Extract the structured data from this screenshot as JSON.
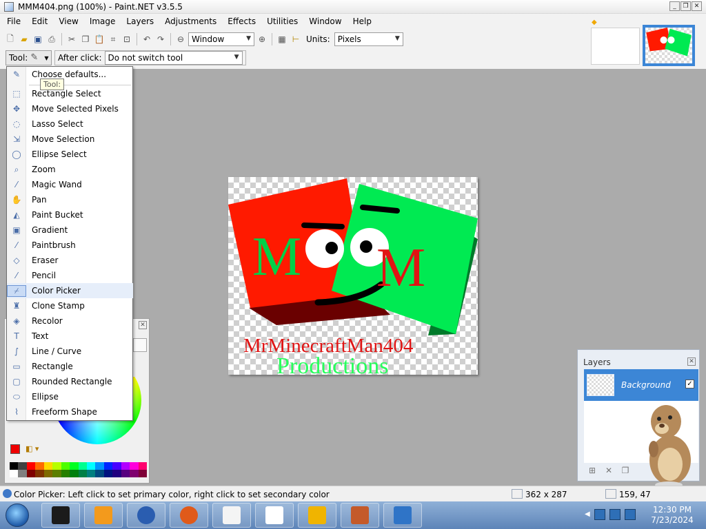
{
  "window": {
    "title": "MMM404.png (100%) - Paint.NET v3.5.5",
    "buttons": {
      "minimize": "_",
      "restore": "❐",
      "close": "✕"
    }
  },
  "menubar": [
    "File",
    "Edit",
    "View",
    "Image",
    "Layers",
    "Adjustments",
    "Effects",
    "Utilities",
    "Window",
    "Help"
  ],
  "toolbar": {
    "zoom_value": "Window",
    "units_label": "Units:",
    "units_value": "Pixels"
  },
  "tool_bar": {
    "tool_label": "Tool:",
    "after_click_label": "After click:",
    "after_click_value": "Do not switch tool",
    "tooltip": "Tool:"
  },
  "tool_menu": {
    "items": [
      {
        "label": "Choose defaults...",
        "icon": "paint-tools-icon"
      },
      {
        "label": "Rectangle Select",
        "icon": "rectangle-select-icon"
      },
      {
        "label": "Move Selected Pixels",
        "icon": "move-pixels-icon"
      },
      {
        "label": "Lasso Select",
        "icon": "lasso-icon"
      },
      {
        "label": "Move Selection",
        "icon": "move-selection-icon"
      },
      {
        "label": "Ellipse Select",
        "icon": "ellipse-select-icon"
      },
      {
        "label": "Zoom",
        "icon": "zoom-icon"
      },
      {
        "label": "Magic Wand",
        "icon": "magic-wand-icon"
      },
      {
        "label": "Pan",
        "icon": "hand-icon"
      },
      {
        "label": "Paint Bucket",
        "icon": "paint-bucket-icon"
      },
      {
        "label": "Gradient",
        "icon": "gradient-icon"
      },
      {
        "label": "Paintbrush",
        "icon": "paintbrush-icon"
      },
      {
        "label": "Eraser",
        "icon": "eraser-icon"
      },
      {
        "label": "Pencil",
        "icon": "pencil-icon"
      },
      {
        "label": "Color Picker",
        "icon": "color-picker-icon",
        "selected": true
      },
      {
        "label": "Clone Stamp",
        "icon": "clone-stamp-icon"
      },
      {
        "label": "Recolor",
        "icon": "recolor-icon"
      },
      {
        "label": "Text",
        "icon": "text-icon"
      },
      {
        "label": "Line / Curve",
        "icon": "line-curve-icon"
      },
      {
        "label": "Rectangle",
        "icon": "rectangle-icon"
      },
      {
        "label": "Rounded Rectangle",
        "icon": "rounded-rectangle-icon"
      },
      {
        "label": "Ellipse",
        "icon": "ellipse-icon"
      },
      {
        "label": "Freeform Shape",
        "icon": "freeform-shape-icon"
      }
    ]
  },
  "canvas": {
    "text_line1": "MrMinecraftMan404",
    "text_line2": "Productions",
    "block_letter": "M",
    "colors": {
      "red": "#ff1a00",
      "green": "#00ea52",
      "dark_red": "#6a0000",
      "dark_green": "#007a2a"
    }
  },
  "layers": {
    "title": "Layers",
    "layer_name": "Background",
    "visible": "✓"
  },
  "palette": [
    "#000000",
    "#404040",
    "#ff0000",
    "#ff6a00",
    "#ffd800",
    "#b6ff00",
    "#4cff00",
    "#00ff21",
    "#00ff90",
    "#00ffff",
    "#0094ff",
    "#0026ff",
    "#4800ff",
    "#b200ff",
    "#ff00dc",
    "#ff006e",
    "#ffffff",
    "#808080",
    "#7f0000",
    "#7f3300",
    "#7f6a00",
    "#5b7f00",
    "#267f00",
    "#007f0e",
    "#007f46",
    "#007f7f",
    "#004a7f",
    "#00137f",
    "#21007f",
    "#57007f",
    "#7f006e",
    "#7f0037"
  ],
  "status": {
    "message": "Color Picker: Left click to set primary color, right click to set secondary color",
    "image_size": "362 x 287",
    "cursor_pos": "159, 47"
  },
  "taskbar": {
    "time": "12:30 PM",
    "date": "7/23/2024",
    "apps": [
      "terminal-icon",
      "media-player-icon",
      "globe-icon",
      "firefox-icon",
      "solitaire-icon",
      "7zip-icon",
      "backup-icon",
      "tools-icon",
      "paintnet-icon"
    ]
  }
}
